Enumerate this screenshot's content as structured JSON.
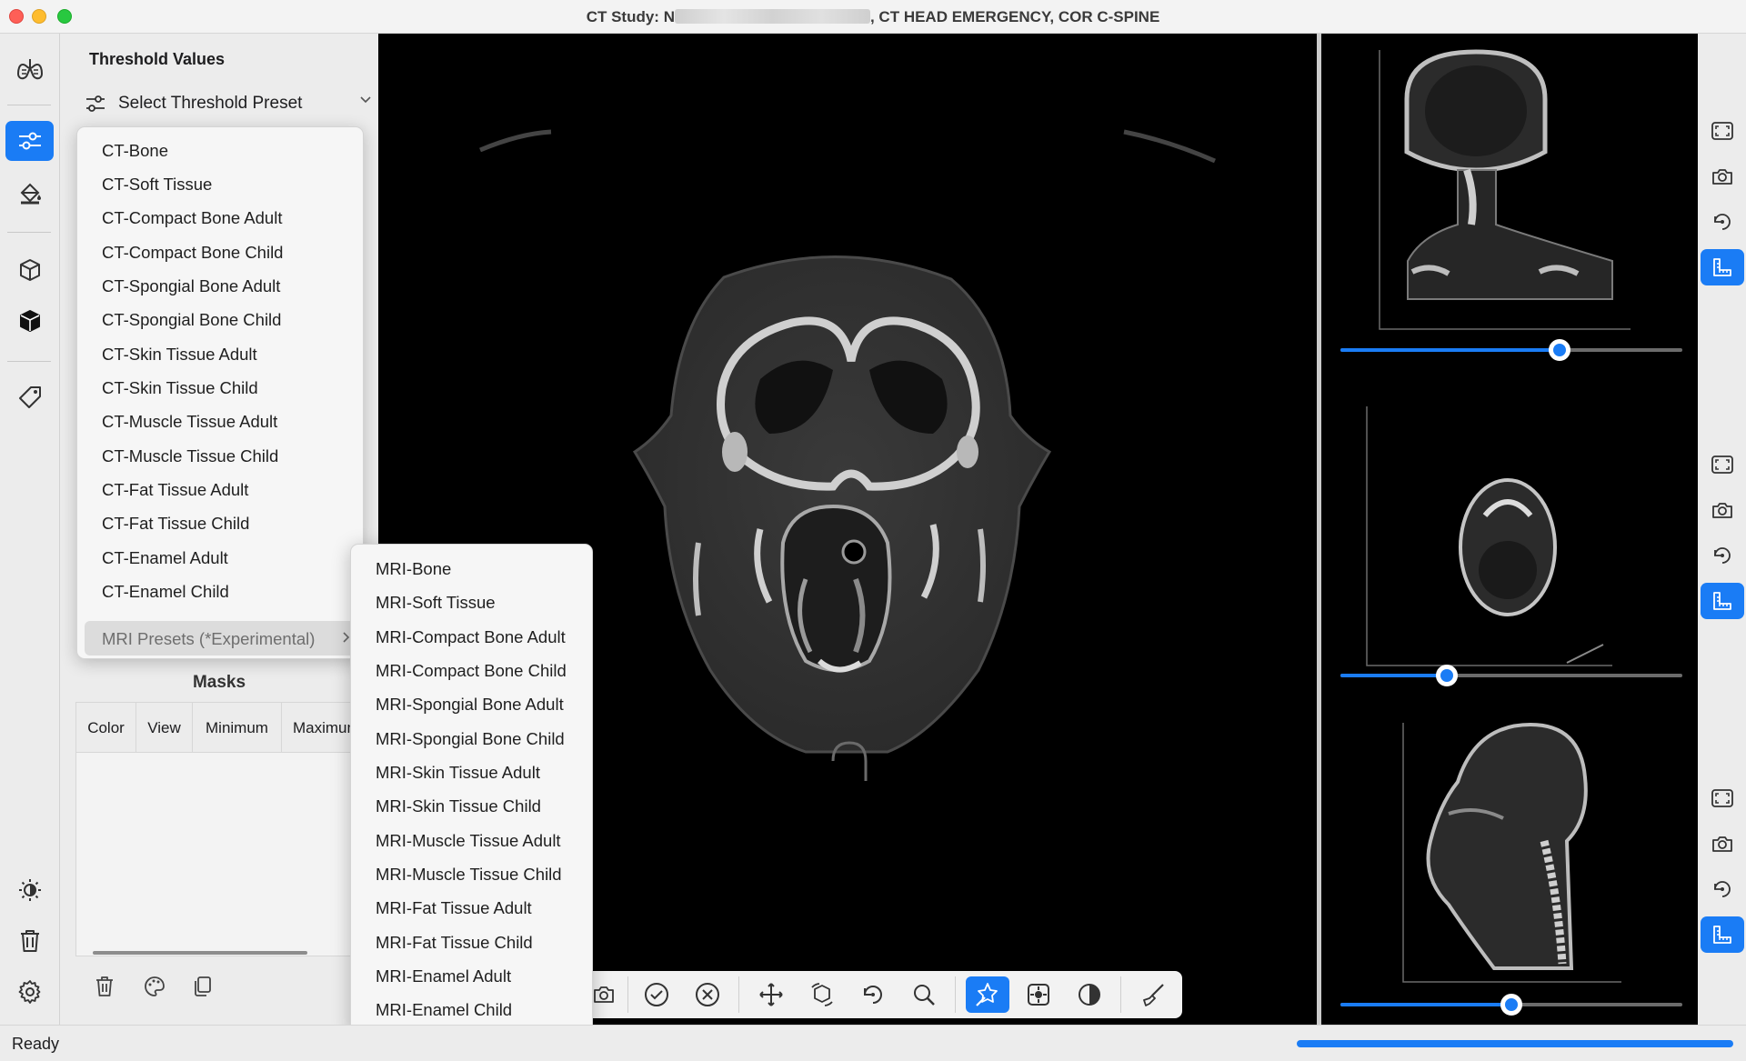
{
  "window": {
    "title_prefix": "CT Study: N",
    "title_suffix": ", CT  HEAD EMERGENCY, COR C-SPINE"
  },
  "rail": {
    "items": [
      {
        "name": "lungs-icon",
        "active": false
      },
      {
        "name": "sliders-icon",
        "active": true
      },
      {
        "name": "paint-bucket-icon",
        "active": false
      },
      {
        "name": "cube-outline-icon",
        "active": false
      },
      {
        "name": "cube-solid-icon",
        "active": false
      },
      {
        "name": "tag-icon",
        "active": false
      },
      {
        "name": "brightness-icon",
        "active": false
      },
      {
        "name": "trash-icon",
        "active": false
      },
      {
        "name": "gear-icon",
        "active": false
      }
    ]
  },
  "panel": {
    "title": "Threshold Values",
    "preset_select": "Select Threshold Preset",
    "ct_presets": [
      "CT-Bone",
      "CT-Soft Tissue",
      "CT-Compact Bone Adult",
      "CT-Compact Bone Child",
      "CT-Spongial Bone Adult",
      "CT-Spongial Bone Child",
      "CT-Skin Tissue Adult",
      "CT-Skin Tissue Child",
      "CT-Muscle Tissue Adult",
      "CT-Muscle Tissue Child",
      "CT-Fat Tissue Adult",
      "CT-Fat Tissue Child",
      "CT-Enamel Adult",
      "CT-Enamel Child"
    ],
    "mri_submenu_label": "MRI Presets (*Experimental)",
    "mri_presets": [
      "MRI-Bone",
      "MRI-Soft Tissue",
      "MRI-Compact Bone Adult",
      "MRI-Compact Bone Child",
      "MRI-Spongial Bone Adult",
      "MRI-Spongial Bone Child",
      "MRI-Skin Tissue Adult",
      "MRI-Skin Tissue Child",
      "MRI-Muscle Tissue Adult",
      "MRI-Muscle Tissue Child",
      "MRI-Fat Tissue Adult",
      "MRI-Fat Tissue Child",
      "MRI-Enamel Adult",
      "MRI-Enamel Child"
    ],
    "masks_title": "Masks",
    "masks_columns": [
      "Color",
      "View",
      "Minimum",
      "Maximum"
    ]
  },
  "right_views": [
    {
      "slider_value": 0.64
    },
    {
      "slider_value": 0.31
    },
    {
      "slider_value": 0.5
    }
  ],
  "status": {
    "text": "Ready",
    "progress": 1.0
  },
  "colors": {
    "accent": "#1a7cf5"
  }
}
